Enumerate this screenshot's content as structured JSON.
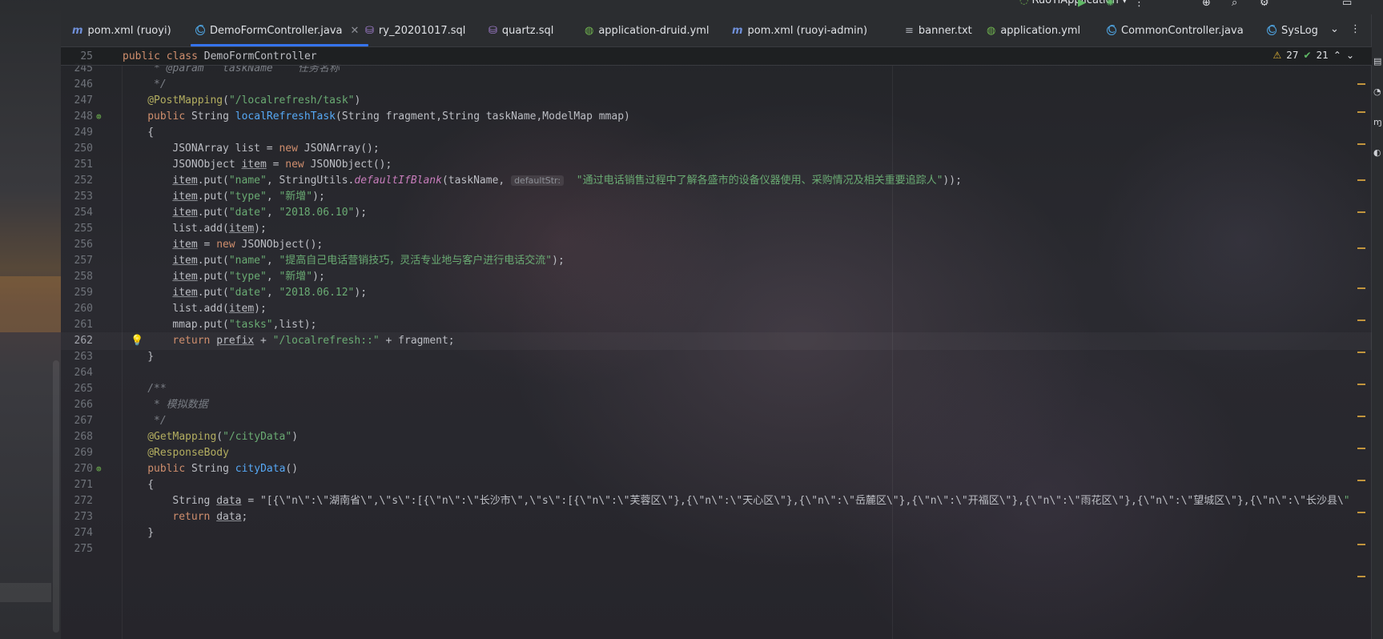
{
  "window": {
    "run_config": "RuoYiApplication",
    "colors": {
      "accent": "#3574f0",
      "string": "#6aab73",
      "keyword": "#cf8e6d",
      "method": "#56a8f5",
      "annotation": "#b3ae60"
    }
  },
  "tabs": [
    {
      "label": "pom.xml (ruoyi)",
      "icon": "maven-icon"
    },
    {
      "label": "DemoFormController.java",
      "icon": "java-class-icon",
      "active": true
    },
    {
      "label": "ry_20201017.sql",
      "icon": "sql-icon"
    },
    {
      "label": "quartz.sql",
      "icon": "sql-icon"
    },
    {
      "label": "application-druid.yml",
      "icon": "yaml-icon"
    },
    {
      "label": "pom.xml (ruoyi-admin)",
      "icon": "maven-icon"
    },
    {
      "label": "banner.txt",
      "icon": "text-file-icon"
    },
    {
      "label": "application.yml",
      "icon": "yaml-icon"
    },
    {
      "label": "CommonController.java",
      "icon": "java-class-icon"
    },
    {
      "label": "SysLog",
      "icon": "java-class-icon"
    }
  ],
  "sticky": {
    "num": "25",
    "code": "public class DemoFormController"
  },
  "inspections": {
    "warnings": "27",
    "ok": "21"
  },
  "hint": "defaultStr:",
  "lines": [
    {
      "n": "245",
      "t": " * @param   taskName    任务名称"
    },
    {
      "n": "246",
      "t": " */"
    },
    {
      "n": "247",
      "t": "@PostMapping(\"/localrefresh/task\")"
    },
    {
      "n": "248",
      "t": "public String localRefreshTask(String fragment,String taskName,ModelMap mmap)"
    },
    {
      "n": "249",
      "t": "{"
    },
    {
      "n": "250",
      "t": "JSONArray list = new JSONArray();"
    },
    {
      "n": "251",
      "t": "JSONObject item = new JSONObject();"
    },
    {
      "n": "252",
      "t": "item.put(\"name\", StringUtils.defaultIfBlank(taskName,  \"通过电话销售过程中了解各盛市的设备仪器使用、采购情况及相关重要追踪人\"));"
    },
    {
      "n": "253",
      "t": "item.put(\"type\", \"新增\");"
    },
    {
      "n": "254",
      "t": "item.put(\"date\", \"2018.06.10\");"
    },
    {
      "n": "255",
      "t": "list.add(item);"
    },
    {
      "n": "256",
      "t": "item = new JSONObject();"
    },
    {
      "n": "257",
      "t": "item.put(\"name\", \"提高自己电话营销技巧，灵活专业地与客户进行电话交流\");"
    },
    {
      "n": "258",
      "t": "item.put(\"type\", \"新增\");"
    },
    {
      "n": "259",
      "t": "item.put(\"date\", \"2018.06.12\");"
    },
    {
      "n": "260",
      "t": "list.add(item);"
    },
    {
      "n": "261",
      "t": "mmap.put(\"tasks\",list);"
    },
    {
      "n": "262",
      "t": "return prefix + \"/localrefresh::\" + fragment;"
    },
    {
      "n": "263",
      "t": "}"
    },
    {
      "n": "264",
      "t": ""
    },
    {
      "n": "265",
      "t": "/**"
    },
    {
      "n": "266",
      "t": " * 模拟数据"
    },
    {
      "n": "267",
      "t": " */"
    },
    {
      "n": "268",
      "t": "@GetMapping(\"/cityData\")"
    },
    {
      "n": "269",
      "t": "@ResponseBody"
    },
    {
      "n": "270",
      "t": "public String cityData()"
    },
    {
      "n": "271",
      "t": "{"
    },
    {
      "n": "272",
      "t": "String data = \"[{\\\"n\\\":\\\"湖南省\\\",\\\"s\\\":[{\\\"n\\\":\\\"长沙市\\\",\\\"s\\\":[{\\\"n\\\":\\\"芙蓉区\\\"},{\\\"n\\\":\\\"天心区\\\"},{\\\"n\\\":\\\"岳麓区\\\"},{\\\"n\\\":\\\"开福区\\\"},{\\\"n\\\":\\\"雨花区\\\"},{\\\"n\\\":\\\"望城区\\\"},{\\\"n\\\":\\\"长沙县\\\""
    },
    {
      "n": "273",
      "t": "return data;"
    },
    {
      "n": "274",
      "t": "}"
    },
    {
      "n": "275",
      "t": ""
    }
  ]
}
